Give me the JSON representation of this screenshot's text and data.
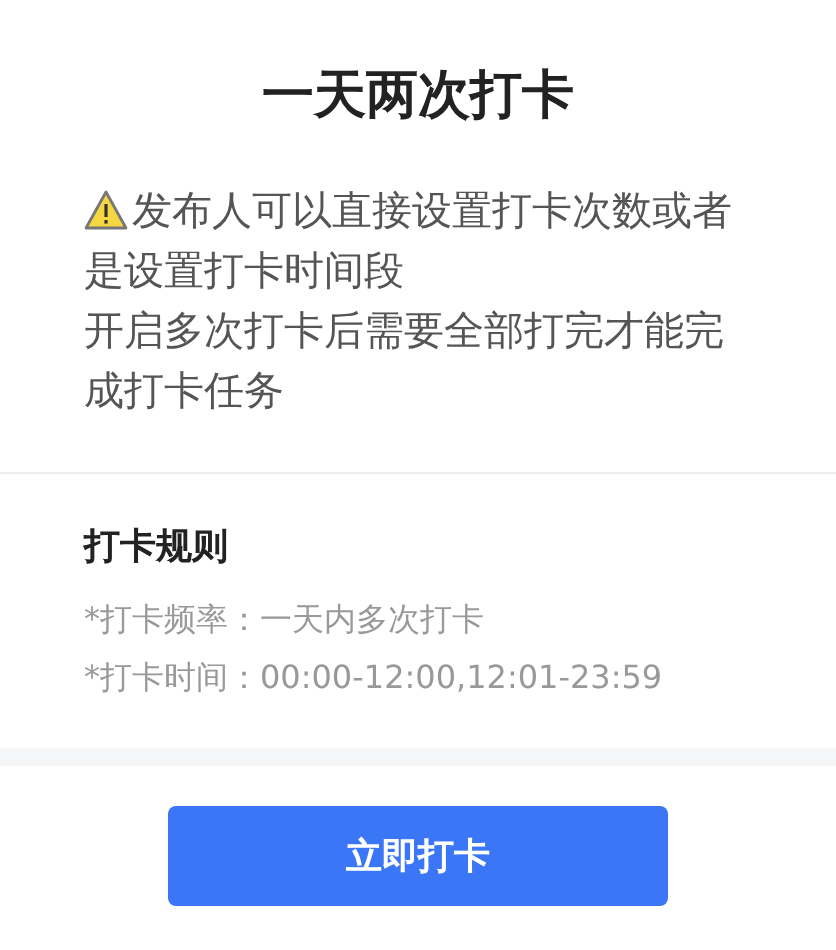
{
  "title": "一天两次打卡",
  "notice": [
    "发布人可以直接设置打卡次数或者",
    "是设置打卡时间段",
    "开启多次打卡后需要全部打完才能完",
    "成打卡任务"
  ],
  "rules": {
    "heading": "打卡规则",
    "items": [
      "*打卡频率：一天内多次打卡",
      "*打卡时间：00:00-12:00,12:01-23:59"
    ]
  },
  "button": "立即打卡"
}
